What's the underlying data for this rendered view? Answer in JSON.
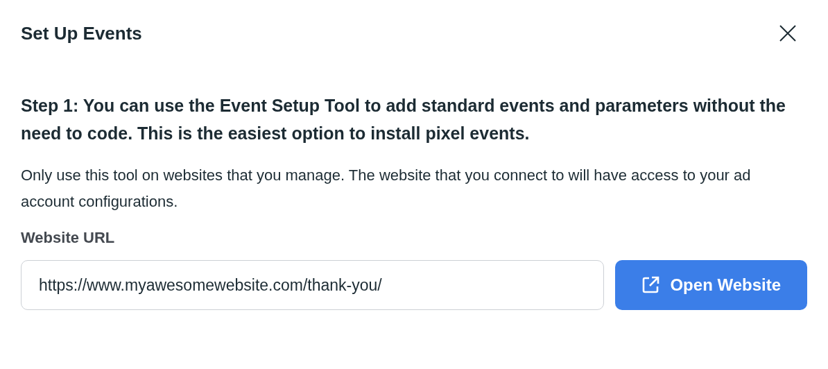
{
  "dialog": {
    "title": "Set Up Events"
  },
  "heading": "Step 1: You can use the Event Setup Tool to add standard events and parameters without the need to code. This is the easiest option to install pixel events.",
  "description": "Only use this tool on websites that you manage. The website that you connect to will have access to your ad account configurations.",
  "url_field": {
    "label": "Website URL",
    "value": "https://www.myawesomewebsite.com/thank-you/"
  },
  "button": "Open Website"
}
